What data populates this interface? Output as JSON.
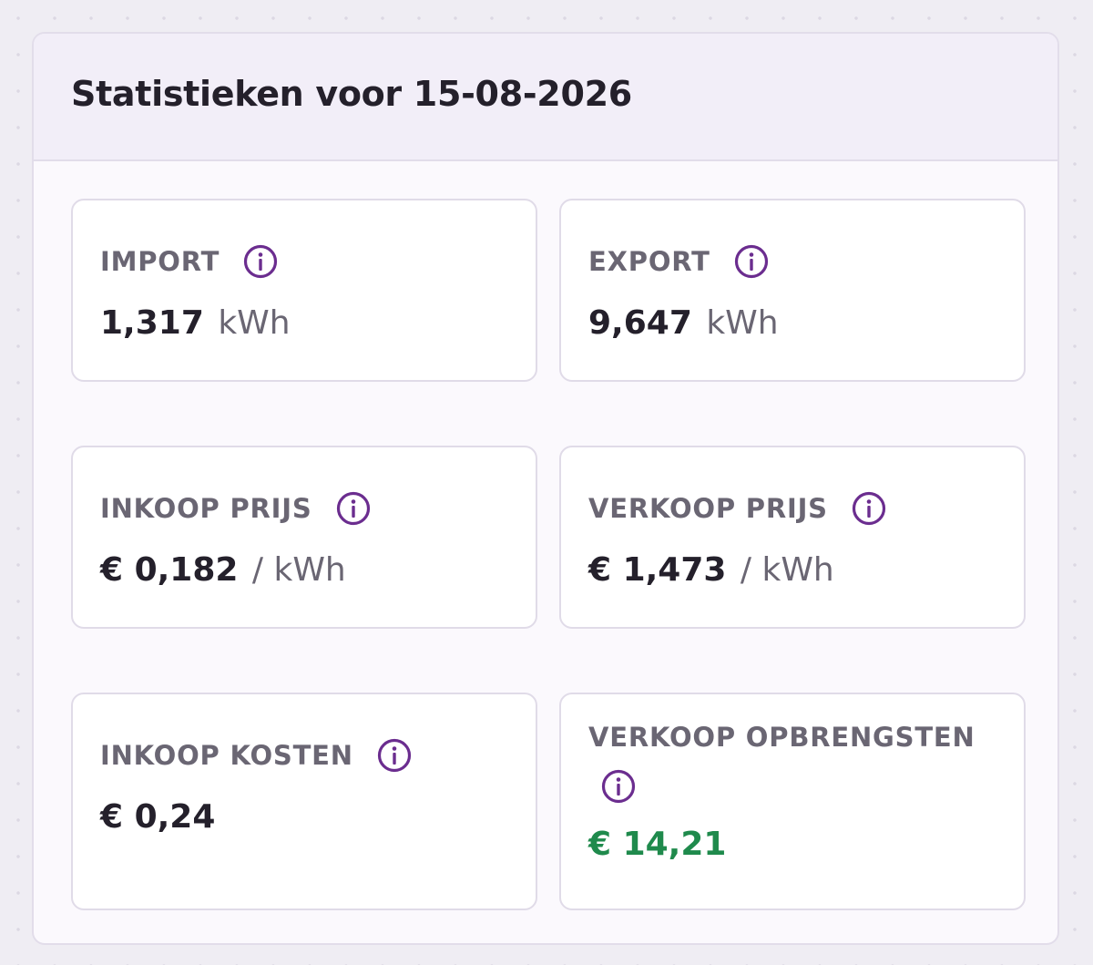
{
  "card": {
    "title": "Statistieken voor 15-08-2026"
  },
  "stats": {
    "import": {
      "label": "IMPORT",
      "value": "1,317",
      "unit": "kWh"
    },
    "export": {
      "label": "EXPORT",
      "value": "9,647",
      "unit": "kWh"
    },
    "inkoop_prijs": {
      "label": "INKOOP PRIJS",
      "value": "€ 0,182",
      "unit": "/ kWh"
    },
    "verkoop_prijs": {
      "label": "VERKOOP PRIJS",
      "value": "€ 1,473",
      "unit": "/ kWh"
    },
    "inkoop_kosten": {
      "label": "INKOOP KOSTEN",
      "value": "€ 0,24"
    },
    "verkoop_opbrengsten": {
      "label": "VERKOOP OPBRENGSTEN",
      "value": "€ 14,21"
    }
  },
  "icons": {
    "info": "info-circle-icon"
  },
  "colors": {
    "accent": "#6b2d8f",
    "positive": "#1f8a4c",
    "text": "#24202b",
    "muted": "#6a6673"
  }
}
